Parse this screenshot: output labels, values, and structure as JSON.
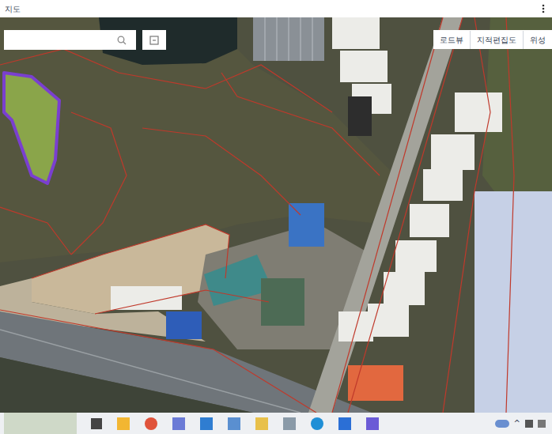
{
  "window": {
    "title": "지도"
  },
  "map_controls": [
    {
      "label": "로드뷰"
    },
    {
      "label": "지적편집도"
    },
    {
      "label": "위성"
    }
  ],
  "tray": {
    "chevron": "^"
  }
}
